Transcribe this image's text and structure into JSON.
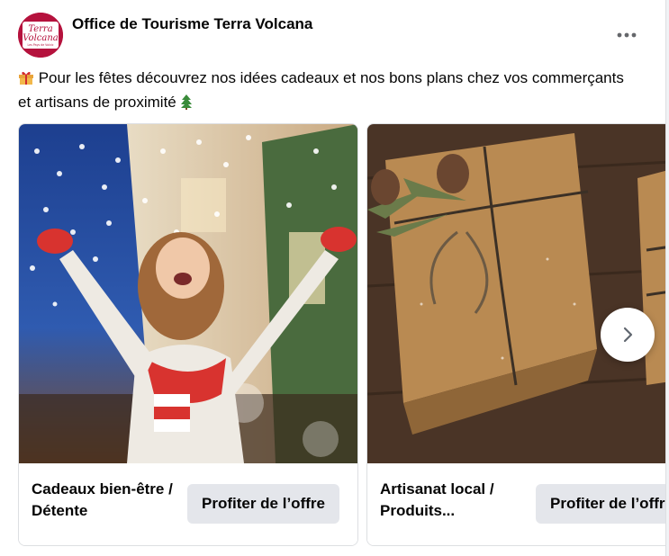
{
  "post": {
    "page_name": "Office de Tourisme Terra Volcana",
    "avatar_text_1": "Terra",
    "avatar_text_2": "Volcana",
    "avatar_text_3": "Les Pays de Volvic",
    "text_before": " Pour les fêtes découvrez nos idées cadeaux et nos bons plans chez vos commerçants et artisans de proximité ",
    "gift_emoji": "🎁",
    "tree_emoji": "🎄",
    "more_icon": "more-horizontal-icon"
  },
  "carousel": {
    "cards": [
      {
        "title": "Cadeaux bien-être / Détente",
        "cta": "Profiter de l’offre"
      },
      {
        "title": "Artisanat local / Produits...",
        "cta": "Profiter de l’offre"
      }
    ],
    "next_icon": "chevron-right-icon"
  },
  "colors": {
    "brand": "#b5123d",
    "cta_bg": "#e4e6eb",
    "text": "#050505"
  }
}
